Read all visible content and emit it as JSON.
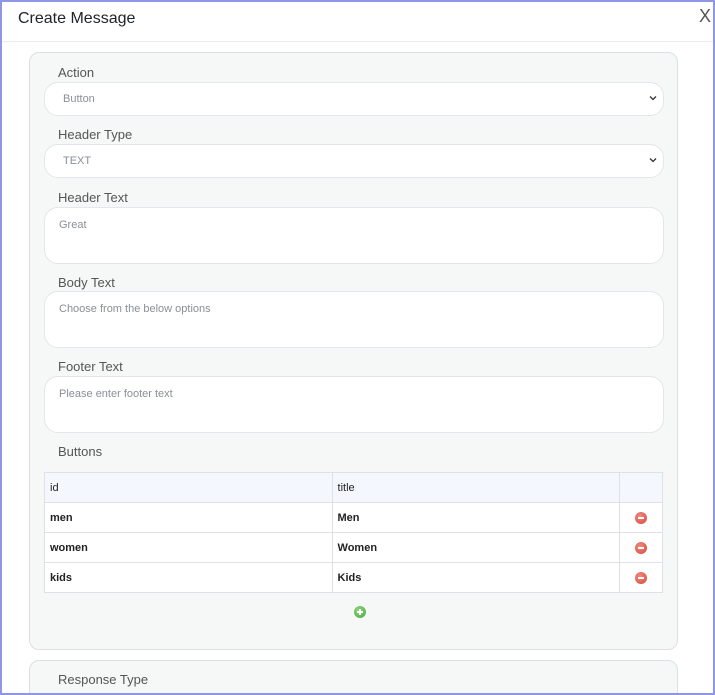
{
  "modal": {
    "title": "Create Message",
    "close_label": "X"
  },
  "form": {
    "action": {
      "label": "Action",
      "value": "Button"
    },
    "header_type": {
      "label": "Header Type",
      "value": "TEXT"
    },
    "header_text": {
      "label": "Header Text",
      "value": "Great"
    },
    "body_text": {
      "label": "Body Text",
      "value": "Choose from the below options"
    },
    "footer_text": {
      "label": "Footer Text",
      "placeholder": "Please enter footer text"
    },
    "buttons": {
      "label": "Buttons",
      "columns": [
        "id",
        "title"
      ],
      "rows": [
        {
          "id": "men",
          "title": "Men"
        },
        {
          "id": "women",
          "title": "Women"
        },
        {
          "id": "kids",
          "title": "Kids"
        }
      ]
    },
    "response_type": {
      "label": "Response Type"
    }
  },
  "colors": {
    "modal_border": "#8f96e6",
    "remove_icon": "#d9463a",
    "add_icon": "#4aa83b"
  }
}
